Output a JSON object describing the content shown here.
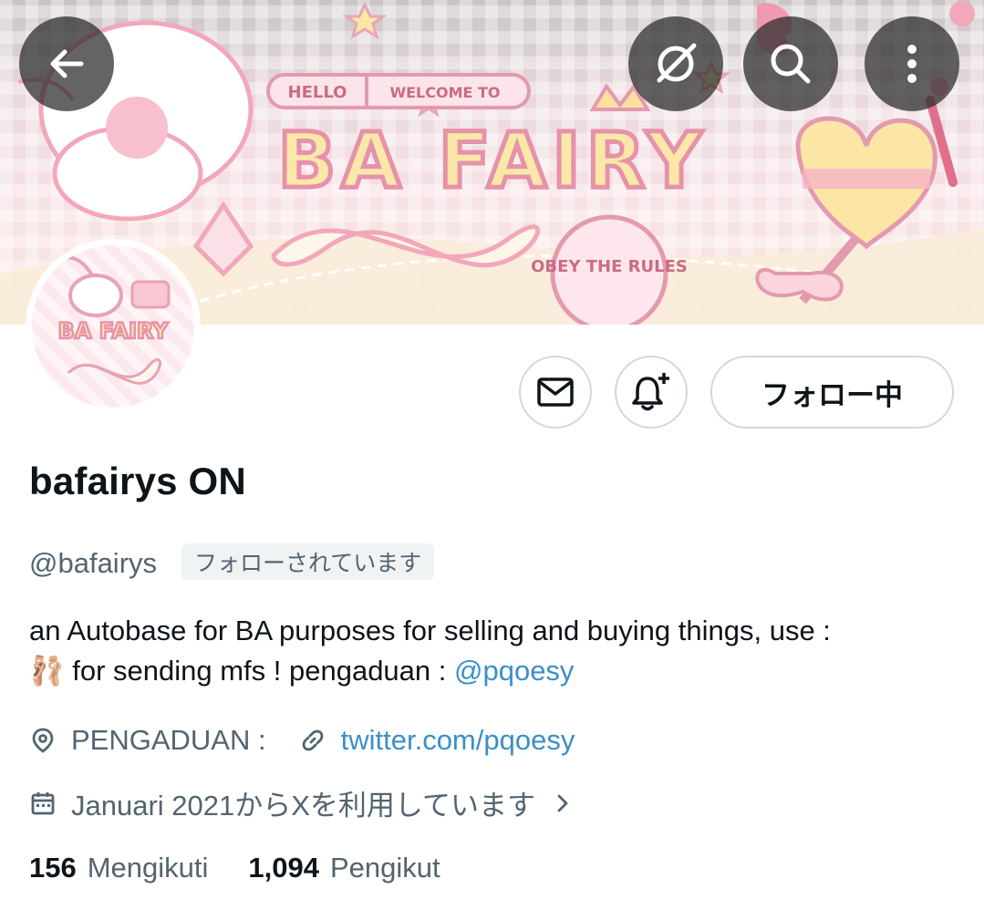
{
  "header": {
    "banner_text": {
      "hello": "HELLO",
      "welcome": "WELCOME TO",
      "title": "BA FAIRY",
      "badge": "OBEY THE RULES"
    },
    "icons": [
      "back-arrow-icon",
      "grok-icon",
      "search-icon",
      "more-vertical-icon"
    ]
  },
  "avatar": {
    "text": "BA FAIRY"
  },
  "actions": {
    "message_icon": "mail-icon",
    "notify_icon": "bell-plus-icon",
    "follow_label": "フォロー中"
  },
  "profile": {
    "display_name": "bafairys ON",
    "handle": "@bafairys",
    "follows_you": "フォローされています",
    "bio_line1": "an Autobase for BA purposes for selling and buying things, use :",
    "bio_line2_emoji": "🩰",
    "bio_line2_text": " for sending mfs ! pengaduan : ",
    "bio_mention": "@pqoesy",
    "location": "PENGADUAN :",
    "website": "twitter.com/pqoesy",
    "joined": "Januari 2021からXを利用しています"
  },
  "stats": {
    "following_count": "156",
    "following_label": "Mengikuti",
    "followers_count": "1,094",
    "followers_label": "Pengikut"
  },
  "colors": {
    "link": "#3b8fc9",
    "secondary_text": "#536471",
    "border": "#cfd9de",
    "banner_pink": "#f4b8c8"
  }
}
